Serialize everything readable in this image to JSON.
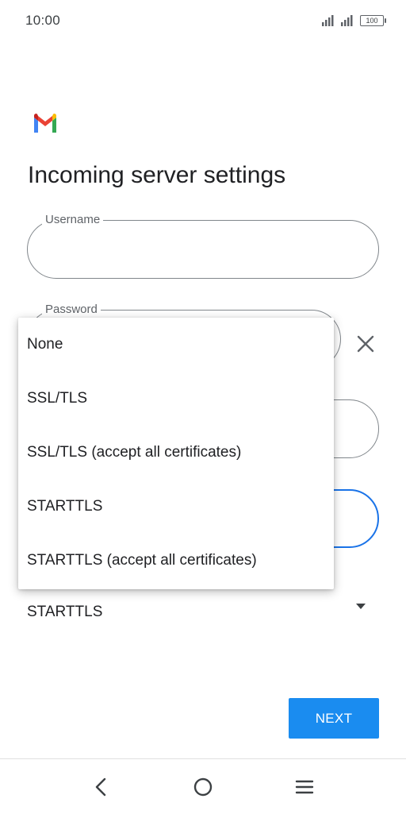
{
  "status_bar": {
    "time": "10:00",
    "battery": "100"
  },
  "header": {
    "title": "Incoming server settings"
  },
  "form": {
    "username_label": "Username",
    "password_label": "Password"
  },
  "security_menu": {
    "options": [
      "None",
      "SSL/TLS",
      "SSL/TLS (accept all certificates)",
      "STARTTLS",
      "STARTTLS (accept all certificates)"
    ],
    "selected": "STARTTLS"
  },
  "actions": {
    "next_label": "NEXT"
  },
  "colors": {
    "accent": "#1a73e8",
    "button": "#1a8cf0"
  },
  "icons": [
    "gmail-logo",
    "close-icon",
    "dropdown-arrow-icon",
    "back-icon",
    "home-icon",
    "menu-icon",
    "signal-icon",
    "battery-icon"
  ]
}
